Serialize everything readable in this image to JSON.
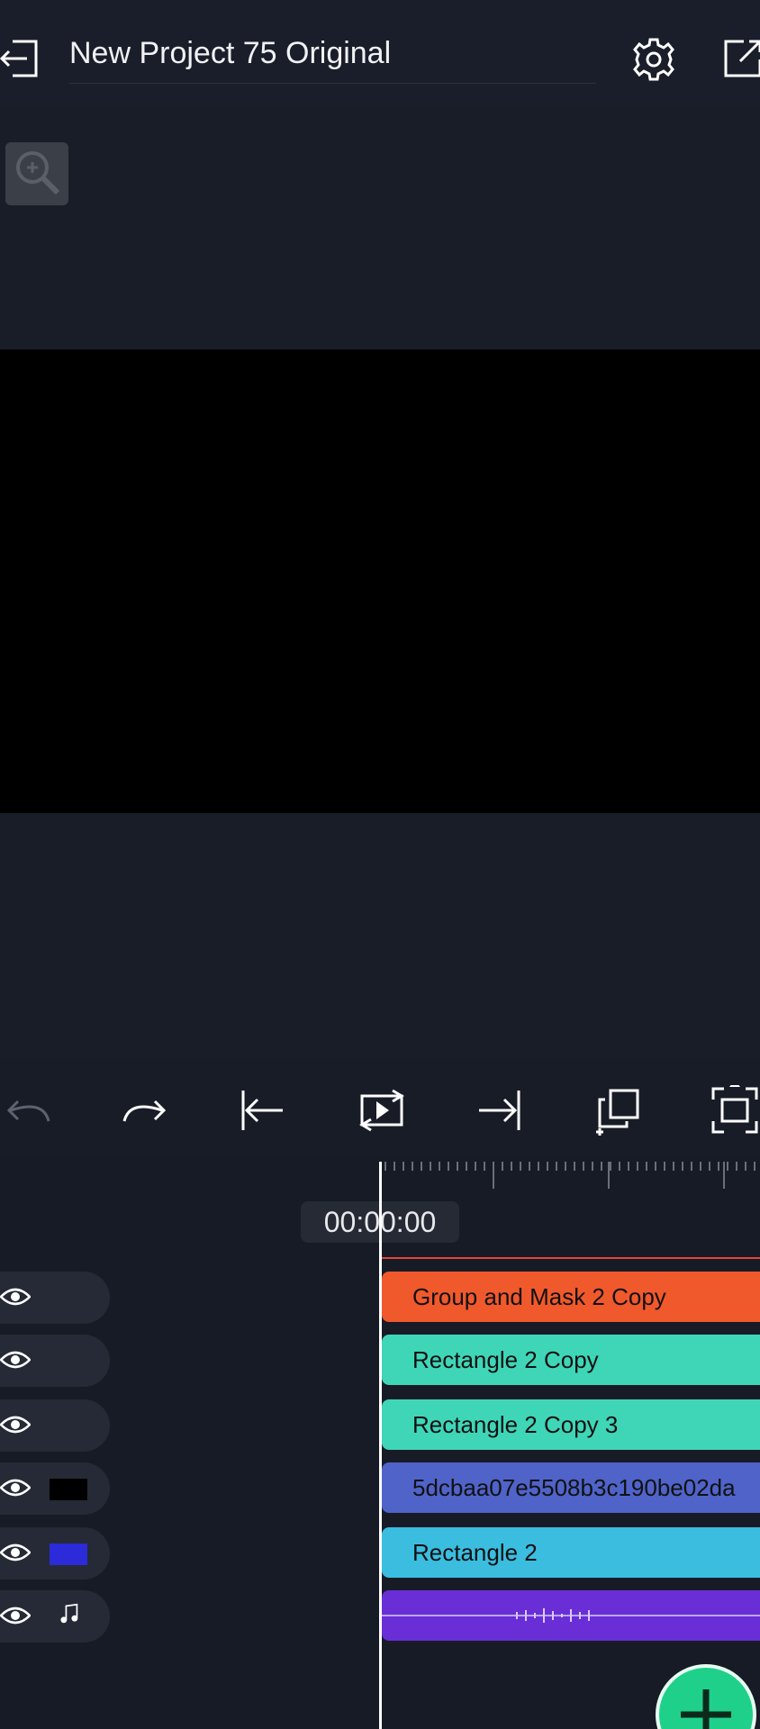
{
  "header": {
    "title": "New Project 75 Original"
  },
  "timeline": {
    "timecode": "00:00:00",
    "tracks": [
      {
        "label": "Group and Mask 2 Copy",
        "color": "#f0592c",
        "thumb": "none"
      },
      {
        "label": "Rectangle 2 Copy",
        "color": "#3fd6b8",
        "thumb": "none"
      },
      {
        "label": "Rectangle 2 Copy 3",
        "color": "#3fd6b8",
        "thumb": "none"
      },
      {
        "label": "5dcbaa07e5508b3c190be02da",
        "color": "#4f63c9",
        "thumb": "black"
      },
      {
        "label": "Rectangle 2",
        "color": "#3bbde0",
        "thumb": "blue"
      },
      {
        "label": "",
        "color": "#6a2ed6",
        "thumb": "music"
      }
    ]
  },
  "colors": {
    "accent": "#1fd08a",
    "background": "#171b26",
    "playhead_line": "#e0453a"
  },
  "icons": {
    "toolbar": [
      "undo-icon",
      "redo-icon",
      "skip-to-start-icon",
      "loop-play-icon",
      "skip-to-end-icon",
      "duplicate-icon",
      "fit-screen-icon"
    ]
  }
}
